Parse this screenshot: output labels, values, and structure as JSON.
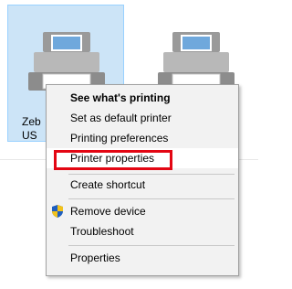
{
  "devices": [
    {
      "label_line1": "Zeb",
      "label_line2": "US",
      "selected": true
    },
    {
      "selected": false
    }
  ],
  "context_menu": {
    "items": [
      {
        "label": "See what's printing",
        "bold": true
      },
      {
        "label": "Set as default printer"
      },
      {
        "label": "Printing preferences"
      },
      {
        "label": "Printer properties",
        "highlighted": true
      },
      {
        "label": "Create shortcut"
      },
      {
        "label": "Remove device",
        "icon": "uac-shield-icon"
      },
      {
        "label": "Troubleshoot"
      },
      {
        "label": "Properties"
      }
    ]
  },
  "colors": {
    "selection_bg": "#cce4f7",
    "highlight_border": "#e30613",
    "menu_bg": "#f2f2f2"
  }
}
